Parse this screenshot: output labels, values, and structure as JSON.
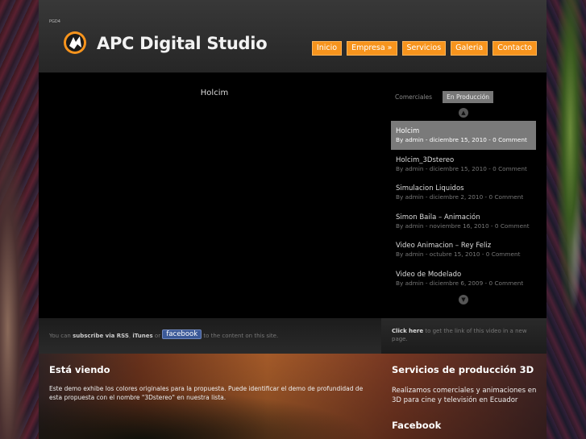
{
  "header": {
    "tiny_label": "PGD4",
    "site_title": "APC Digital Studio",
    "nav": [
      "Inicio",
      "Empresa »",
      "Servicios",
      "Galeria",
      "Contacto"
    ]
  },
  "video": {
    "title": "Holcim"
  },
  "playlist": {
    "tabs": [
      "Comerciales",
      "En Producción"
    ],
    "active_tab": "En Producción",
    "up_icon": "▲",
    "down_icon": "▼",
    "items": [
      {
        "title": "Holcim",
        "meta": "By admin - diciembre 15, 2010 - 0 Comment"
      },
      {
        "title": "Holcim_3Dstereo",
        "meta": "By admin - diciembre 15, 2010 - 0 Comment"
      },
      {
        "title": "Simulacion Liquidos",
        "meta": "By admin - diciembre 2, 2010 - 0 Comment"
      },
      {
        "title": "Simon Baila – Animación",
        "meta": "By admin - noviembre 16, 2010 - 0 Comment"
      },
      {
        "title": "Video Animacion – Rey Feliz",
        "meta": "By admin - octubre 15, 2010 - 0 Comment"
      },
      {
        "title": "Video de Modelado",
        "meta": "By admin - diciembre 6, 2009 - 0 Comment"
      }
    ]
  },
  "subscribe": {
    "prefix": "You can",
    "rss": "subscribe via RSS",
    "sep1": ",",
    "itunes": "iTunes",
    "or": "or",
    "facebook": "facebook",
    "suffix": "to the content on this site."
  },
  "clickhere": {
    "bold": "Click here",
    "text": "to get the link of this video in a new page."
  },
  "footer": {
    "left_title": "Está viendo",
    "left_text": "Este demo exhibe los colores originales para la propuesta. Puede identificar el demo de profundidad de esta propuesta con el nombre \"3Dstereo\" en nuestra lista.",
    "right_title": "Servicios de producción 3D",
    "right_text": "Realizamos comerciales y animaciones en 3D para cine y televisión en Ecuador",
    "facebook_title": "Facebook"
  },
  "colors": {
    "nav_orange": "#f7941d",
    "facebook_blue": "#3b5998"
  }
}
